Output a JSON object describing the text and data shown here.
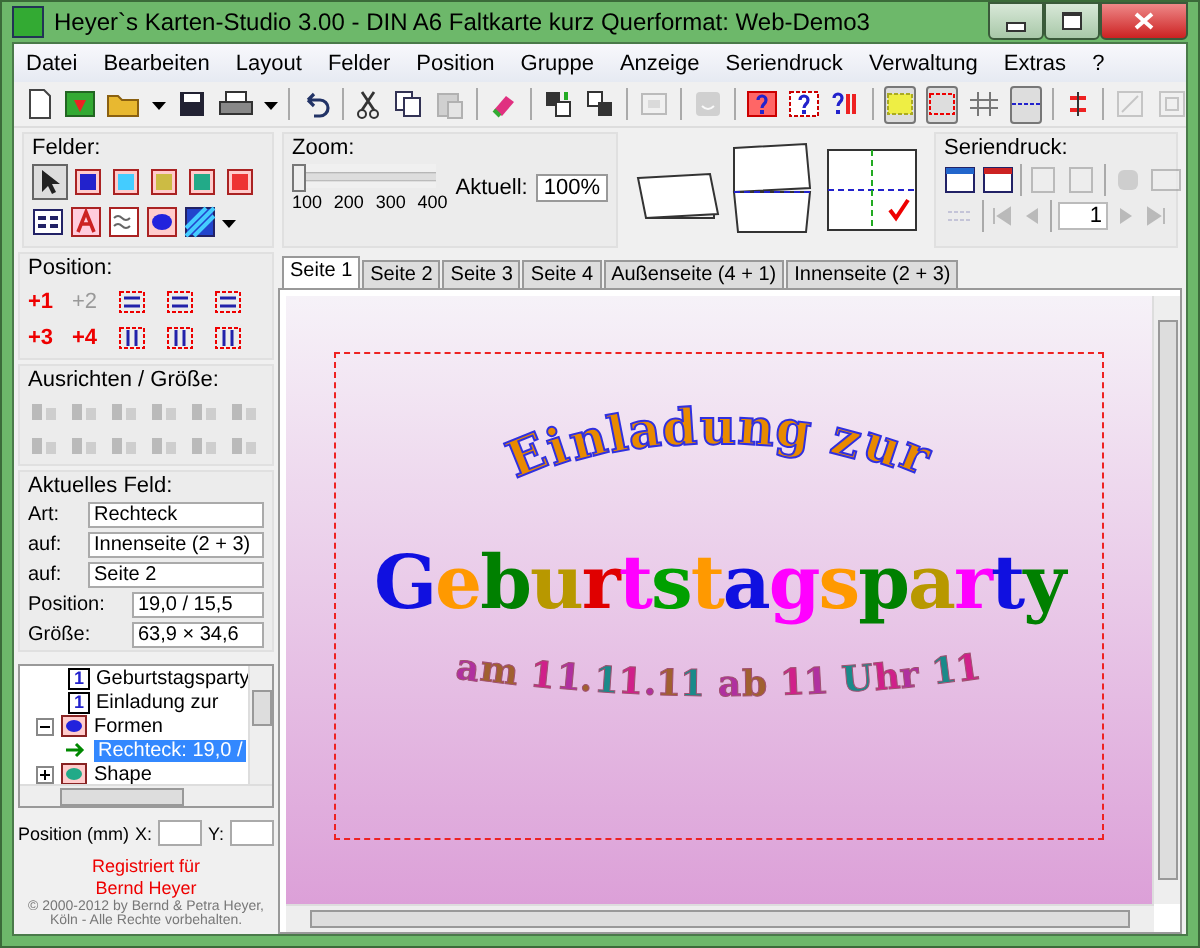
{
  "window": {
    "title": "Heyer`s Karten-Studio 3.00 - DIN A6 Faltkarte kurz Querformat: Web-Demo3"
  },
  "menu": [
    {
      "label": "Datei"
    },
    {
      "label": "Bearbeiten"
    },
    {
      "label": "Layout"
    },
    {
      "label": "Felder"
    },
    {
      "label": "Position"
    },
    {
      "label": "Gruppe"
    },
    {
      "label": "Anzeige"
    },
    {
      "label": "Seriendruck"
    },
    {
      "label": "Verwaltung"
    },
    {
      "label": "Extras"
    },
    {
      "label": "?"
    }
  ],
  "toolbar": {
    "toggles": [
      {
        "selected": true
      },
      {
        "selected": true
      },
      {
        "selected": false
      },
      {
        "selected": true
      }
    ]
  },
  "felder": {
    "title": "Felder:",
    "tools": [
      {
        "selected": true
      },
      {
        "selected": false
      },
      {
        "selected": false
      },
      {
        "selected": false
      },
      {
        "selected": false
      },
      {
        "selected": false
      }
    ]
  },
  "zoom": {
    "title": "Zoom:",
    "level": 0,
    "ticks": [
      "100",
      "200",
      "300",
      "400"
    ],
    "current_label": "Aktuell:",
    "current": "100%"
  },
  "seriendruck": {
    "title": "Seriendruck:",
    "record": "1"
  },
  "position": {
    "title": "Position:",
    "buttons": [
      {
        "label": "+1",
        "disabled": false
      },
      {
        "label": "+2",
        "disabled": true
      },
      {
        "label": "+3",
        "disabled": false
      },
      {
        "label": "+4",
        "disabled": false
      }
    ]
  },
  "ausrichten": {
    "title": "Ausrichten / Größe:"
  },
  "aktuelles_feld": {
    "title": "Aktuelles Feld:",
    "rows": [
      {
        "label": "Art:",
        "value": "Rechteck"
      },
      {
        "label": "auf:",
        "value": "Innenseite (2 + 3)"
      },
      {
        "label": "auf:",
        "value": "Seite 2"
      },
      {
        "label": "Position:",
        "value": "19,0 / 15,5"
      },
      {
        "label": "Größe:",
        "value": "63,9 × 34,6"
      }
    ]
  },
  "tree": {
    "items": [
      {
        "label": "Geburtstagsparty",
        "kind": "text",
        "number": "1",
        "selected": false
      },
      {
        "label": "Einladung zur",
        "kind": "text",
        "number": "1",
        "selected": false
      },
      {
        "label": "Formen",
        "kind": "group",
        "expanded": true,
        "selected": false,
        "children": [
          {
            "label": "Rechteck: 19,0 /",
            "kind": "shape",
            "selected": true
          }
        ]
      },
      {
        "label": "Shape",
        "kind": "group",
        "expanded": false,
        "selected": false
      }
    ]
  },
  "coords": {
    "label": "Position (mm)",
    "x_label": "X:",
    "y_label": "Y:"
  },
  "registration": {
    "line1": "Registriert für",
    "line2": "Bernd Heyer",
    "copyright": "© 2000-2012 by Bernd & Petra Heyer, Köln - Alle Rechte vorbehalten."
  },
  "tabs": [
    {
      "label": "Seite 1",
      "selected": true
    },
    {
      "label": "Seite 2",
      "selected": false
    },
    {
      "label": "Seite 3",
      "selected": false
    },
    {
      "label": "Seite 4",
      "selected": false
    },
    {
      "label": "Außenseite (4 + 1)",
      "selected": false
    },
    {
      "label": "Innenseite (2 + 3)",
      "selected": false
    }
  ],
  "card": {
    "heading": "Einladung zur",
    "title": "Geburtstagsparty",
    "subtitle": "am 11.11.11 ab 11 Uhr 11"
  }
}
